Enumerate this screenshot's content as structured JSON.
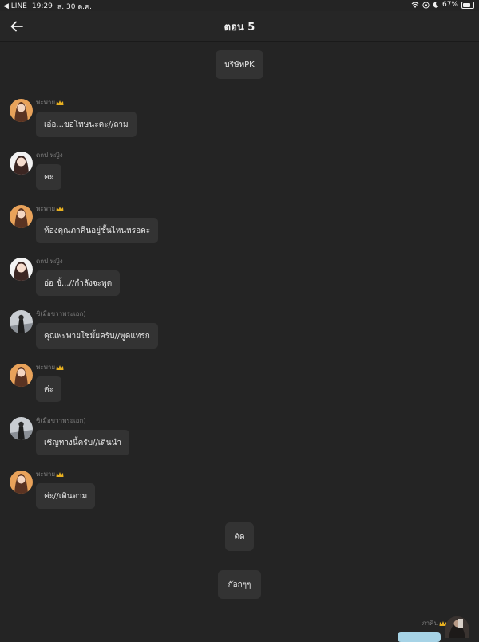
{
  "status_bar": {
    "carrier": "◀ LINE",
    "time": "19:29",
    "date": "ส. 30 ต.ค.",
    "battery": "67%"
  },
  "nav": {
    "title": "ตอน 5"
  },
  "center_messages": [
    {
      "text": "บริษัทPK"
    },
    {
      "text": "ตัด"
    },
    {
      "text": "ก๊อกๆๆ"
    }
  ],
  "messages": [
    {
      "name": "พะพาย",
      "text": "เอ่อ...ขอโทษนะคะ//ถาม"
    },
    {
      "name": "ตกป.หญิง",
      "text": "คะ"
    },
    {
      "name": "พะพาย",
      "text": "ห้องคุณภาคินอยู่ชั้นไหนหรอคะ"
    },
    {
      "name": "ตกป.หญิง",
      "text": "อ่อ ชั้...//กำลังจะพูด"
    },
    {
      "name": "ชิ(มือขวาพระเอก)",
      "text": "คุณพะพายใช่มั้ยครับ//พูดแทรก"
    },
    {
      "name": "พะพาย",
      "text": "ค่ะ"
    },
    {
      "name": "ชิ(มือขวาพระเอก)",
      "text": "เชิญทางนี้ครับ//เดินนำ"
    },
    {
      "name": "พะพาย",
      "text": "ค่ะ//เดินตาม"
    }
  ],
  "right_message": {
    "name": "ภาคิน"
  },
  "colors": {
    "background": "#242424",
    "bubble": "#333333",
    "name_text": "#7d7d7d",
    "crown": "#e8b020",
    "own_bubble": "#a6d3e6"
  }
}
